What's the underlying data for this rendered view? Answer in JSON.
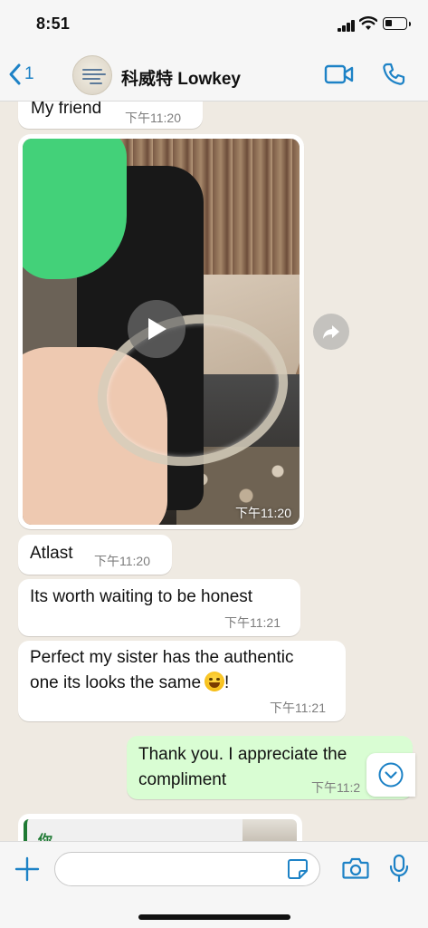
{
  "status_bar": {
    "time": "8:51"
  },
  "header": {
    "back_count": "1",
    "contact_name": "科威特 Lowkey"
  },
  "messages": [
    {
      "direction": "incoming",
      "text": "My friend",
      "time": "下午11:20"
    },
    {
      "direction": "incoming",
      "type": "video",
      "time": "下午11:20"
    },
    {
      "direction": "incoming",
      "text": "Atlast",
      "time": "下午11:20"
    },
    {
      "direction": "incoming",
      "text": "Its worth waiting to be honest",
      "time": "下午11:21"
    },
    {
      "direction": "incoming",
      "text_line1": "Perfect my sister has the authentic",
      "text_line2": "one its looks the same",
      "emoji": "grinning-sweat",
      "text_end": "!",
      "time": "下午11:21"
    },
    {
      "direction": "outgoing",
      "text_line1": "Thank you. I appreciate the",
      "text_line2": "compliment",
      "time": "下午11:2"
    }
  ],
  "reply_preview": {
    "sender": "你"
  },
  "composer": {
    "value": "",
    "placeholder": ""
  },
  "colors": {
    "accent": "#1d82c6",
    "outgoing_bubble": "#d9fdd3",
    "incoming_bubble": "#ffffff",
    "chat_background": "#efeae2"
  },
  "icons": {
    "back": "chevron-left-icon",
    "video_call": "video-camera-icon",
    "voice_call": "phone-icon",
    "play": "play-icon",
    "forward": "forward-icon",
    "scroll_down": "chevron-down-icon",
    "attach": "plus-icon",
    "sticker": "sticker-icon",
    "camera": "camera-icon",
    "mic": "microphone-icon"
  }
}
